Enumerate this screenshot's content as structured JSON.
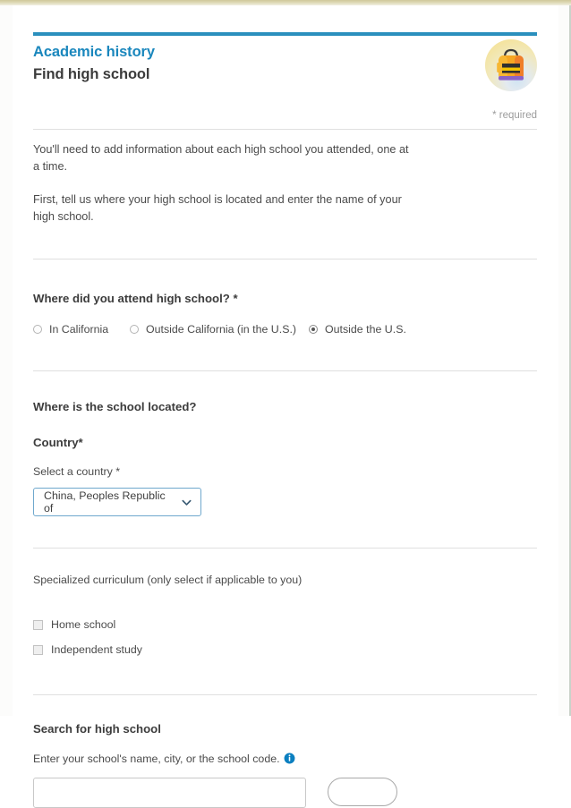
{
  "header": {
    "section_title": "Academic history",
    "page_title": "Find high school",
    "badge_icon": "backpack-icon",
    "required_note": "* required"
  },
  "intro": {
    "paragraph_1": "You'll need to add information about each high school you attended, one at a time.",
    "paragraph_2": "First, tell us where your high school is located and enter the name of your high school."
  },
  "attend_question": {
    "label": "Where did you attend high school? *",
    "options": [
      {
        "label": "In California",
        "selected": false
      },
      {
        "label": "Outside California (in the U.S.)",
        "selected": false
      },
      {
        "label": "Outside the U.S.",
        "selected": true
      }
    ]
  },
  "location": {
    "heading": "Where is the school located?",
    "country_heading": "Country*",
    "select_label": "Select a country *",
    "select_value": "China, Peoples Republic of",
    "chevron_icon": "chevron-down-icon"
  },
  "curriculum": {
    "label": "Specialized curriculum (only select if applicable to you)",
    "options": [
      {
        "label": "Home school",
        "checked": false
      },
      {
        "label": "Independent study",
        "checked": false
      }
    ]
  },
  "search": {
    "heading": "Search for high school",
    "hint": "Enter your school's name, city, or the school code.",
    "info_icon": "info-icon",
    "input_value": "",
    "input_placeholder": ""
  },
  "colors": {
    "accent_blue": "#1a87bd",
    "rule_blue": "#2a8fbd",
    "info_blue": "#0b7fc0",
    "text": "#4b4b4b",
    "heading": "#3c3c3c",
    "divider": "#dfdfdf",
    "focus_border": "#6fa8cd",
    "top_band": "#cfc89a"
  }
}
